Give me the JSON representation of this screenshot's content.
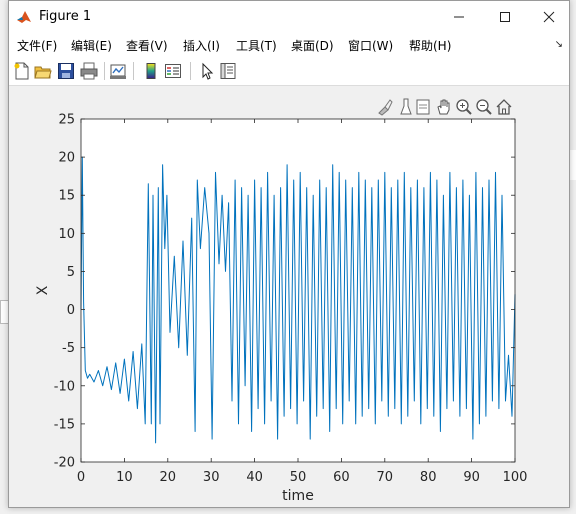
{
  "window": {
    "title": "Figure 1",
    "controls": {
      "minimize_icon": "minimize-icon",
      "maximize_icon": "maximize-icon",
      "close_icon": "close-icon"
    }
  },
  "menu": {
    "items": [
      "文件(F)",
      "编辑(E)",
      "查看(V)",
      "插入(I)",
      "工具(T)",
      "桌面(D)",
      "窗口(W)",
      "帮助(H)"
    ]
  },
  "toolbar": {
    "icons": [
      "new-figure-icon",
      "open-file-icon",
      "save-icon",
      "print-icon",
      "link-plot-icon",
      "insert-colorbar-icon",
      "insert-legend-icon",
      "edit-plot-icon",
      "property-inspector-icon"
    ]
  },
  "axes_toolbar": {
    "icons": [
      "brush-icon",
      "data-tips-icon",
      "export-icon",
      "pan-icon",
      "zoom-in-icon",
      "zoom-out-icon",
      "home-icon"
    ]
  },
  "chart_data": {
    "type": "line",
    "xlabel": "time",
    "ylabel": "X",
    "title": "",
    "xlim": [
      0,
      100
    ],
    "ylim": [
      -20,
      25
    ],
    "xticks": [
      0,
      10,
      20,
      30,
      40,
      50,
      60,
      70,
      80,
      90,
      100
    ],
    "yticks": [
      -20,
      -15,
      -10,
      -5,
      0,
      5,
      10,
      15,
      20,
      25
    ],
    "grid": false,
    "color": "#0072BD",
    "series": [
      {
        "x": [
          0,
          0.3,
          0.6,
          1.0,
          1.5,
          2,
          3,
          4,
          5,
          6,
          7,
          8,
          9,
          10,
          11,
          12,
          13,
          14,
          14.8,
          15.5,
          16.2,
          16.6,
          17.2,
          17.8,
          18.2,
          18.8,
          19.3,
          19.8,
          20.5,
          21.5,
          22.5,
          23.5,
          24.5,
          25.5,
          26.3,
          26.8,
          27.5,
          28.5,
          29.5,
          30.2,
          31.0,
          31.8,
          32.5,
          33.3,
          34.0,
          34.8,
          35.5,
          36.3,
          37.0,
          37.8,
          38.5,
          39.3,
          40.0,
          40.8,
          41.5,
          42.3,
          43.0,
          43.8,
          44.5,
          45.3,
          46.0,
          46.8,
          47.5,
          48.3,
          49.0,
          49.8,
          50.5,
          51.3,
          52.0,
          52.8,
          53.5,
          54.3,
          55.0,
          55.8,
          56.5,
          57.3,
          58.0,
          58.8,
          59.5,
          60.3,
          61.0,
          61.8,
          62.5,
          63.3,
          64.0,
          64.8,
          65.5,
          66.3,
          67.0,
          67.8,
          68.5,
          69.3,
          70.0,
          70.8,
          71.5,
          72.3,
          73.0,
          73.8,
          74.5,
          75.3,
          76.0,
          76.8,
          77.5,
          78.3,
          79.0,
          79.8,
          80.5,
          81.3,
          82.0,
          82.8,
          83.5,
          84.3,
          85.0,
          85.8,
          86.5,
          87.3,
          88.0,
          88.8,
          89.5,
          90.3,
          91.0,
          91.8,
          92.5,
          93.3,
          94.0,
          94.8,
          95.5,
          96.3,
          97.0,
          97.8,
          98.5,
          99.3,
          100
        ],
        "y": [
          0,
          20,
          1,
          -8,
          -9,
          -8.5,
          -9.5,
          -8,
          -10,
          -7.5,
          -10.5,
          -7,
          -11,
          -6.5,
          -12,
          -5.5,
          -13,
          -4.5,
          -15,
          16.5,
          -15,
          15,
          -17.5,
          16,
          -15,
          19,
          8,
          15,
          -3,
          7,
          -5,
          9,
          -6,
          12,
          -16,
          17,
          8,
          16,
          10,
          -17,
          18,
          6,
          15,
          5,
          14,
          -12,
          17,
          -15,
          16,
          -10,
          15,
          -16,
          17,
          -13,
          16,
          -15,
          18,
          -12,
          15,
          -17,
          16,
          -14,
          19,
          -13,
          17,
          -15,
          18,
          -12,
          16,
          -17,
          15,
          -14,
          17,
          -13,
          16,
          -16,
          19,
          -13,
          18,
          -15,
          17,
          -12,
          16,
          -15,
          18,
          -14,
          17,
          -13,
          16,
          -15,
          17,
          -12,
          18,
          -14,
          16,
          -13,
          17,
          -15,
          18,
          -14,
          16,
          -12,
          17,
          -15,
          16,
          -13,
          18,
          -14,
          17,
          -16,
          15,
          -13,
          18,
          -12,
          16,
          -14,
          17,
          -13,
          15,
          -17,
          18,
          -15,
          16,
          -14,
          17,
          -12,
          18,
          -13,
          15,
          -12,
          -6,
          -14,
          2
        ]
      }
    ]
  }
}
